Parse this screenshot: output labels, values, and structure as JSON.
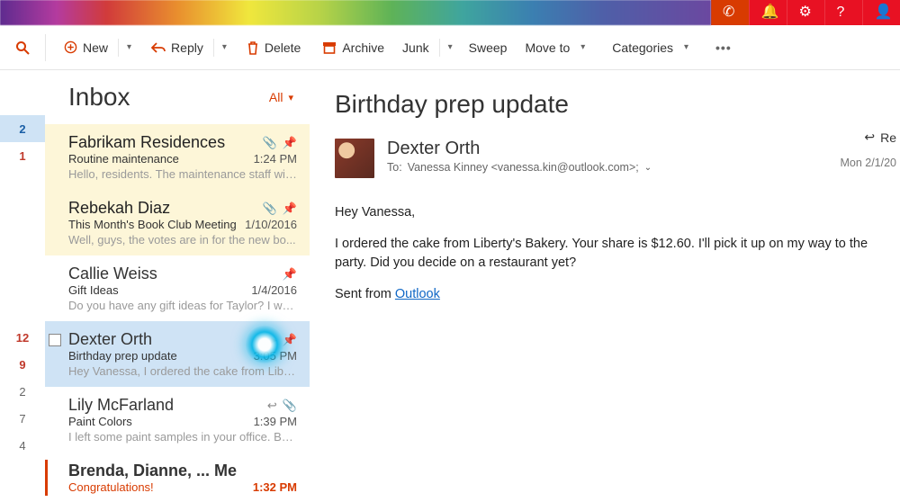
{
  "toolbar": {
    "new": "New",
    "reply": "Reply",
    "delete": "Delete",
    "archive": "Archive",
    "junk": "Junk",
    "sweep": "Sweep",
    "moveto": "Move to",
    "categories": "Categories"
  },
  "list": {
    "title": "Inbox",
    "filter": "All"
  },
  "gutter_counts": [
    "2",
    "1",
    "12",
    "9",
    "2",
    "7",
    "4"
  ],
  "messages": [
    {
      "from": "Fabrikam Residences",
      "subject": "Routine maintenance",
      "date": "1:24 PM",
      "preview": "Hello, residents. The maintenance staff will...",
      "unread": true,
      "attach": true,
      "pin": true
    },
    {
      "from": "Rebekah Diaz",
      "subject": "This Month's Book Club Meeting",
      "date": "1/10/2016",
      "preview": "Well, guys, the votes are in for the new bo...",
      "unread": true,
      "attach": true,
      "pin": true
    },
    {
      "from": "Callie Weiss",
      "subject": "Gift Ideas",
      "date": "1/4/2016",
      "preview": "Do you have any gift ideas for Taylor? I wa...",
      "unread": false,
      "pin": true
    },
    {
      "from": "Dexter Orth",
      "subject": "Birthday prep update",
      "date": "3:05 PM",
      "preview": "Hey Vanessa, I ordered the cake from Liber...",
      "selected": true,
      "flag": true,
      "pin_grey": true
    },
    {
      "from": "Lily McFarland",
      "subject": "Paint Colors",
      "date": "1:39 PM",
      "preview": "I left some paint samples in your office. Be...",
      "replied": true,
      "attach": true
    },
    {
      "from": "Brenda, Dianne, ... Me",
      "subject": "Congratulations!",
      "date": "1:32 PM",
      "preview": "",
      "flag_red": true,
      "bold_red_date": true
    }
  ],
  "reading": {
    "title": "Birthday prep update",
    "sender": "Dexter Orth",
    "to_label": "To:",
    "recipients": "Vanessa Kinney <vanessa.kin@outlook.com>;",
    "date": "Mon 2/1/20",
    "reply_label": "Re",
    "body_p1": "Hey Vanessa,",
    "body_p2": "I ordered the cake from Liberty's Bakery. Your share is $12.60. I'll pick it up on my way to the party. Did you decide on a restaurant yet?",
    "body_sentfrom": "Sent from ",
    "body_link": "Outlook"
  }
}
